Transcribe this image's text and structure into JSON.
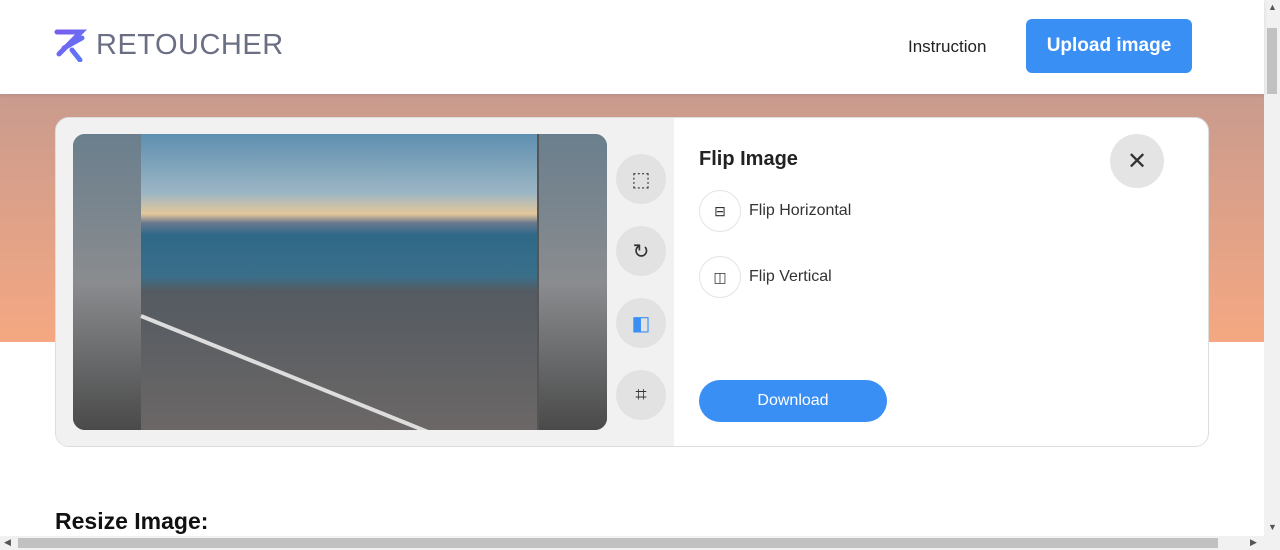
{
  "header": {
    "logo_text": "RETOUCHER",
    "instruction": "Instruction",
    "upload_label": "Upload image"
  },
  "editor": {
    "panel_title": "Flip Image",
    "options": [
      {
        "label": "Flip Horizontal",
        "icon": "flip-horizontal-icon"
      },
      {
        "label": "Flip Vertical",
        "icon": "flip-vertical-icon"
      }
    ],
    "download_label": "Download",
    "tools": [
      "resize-icon",
      "rotate-icon",
      "flip-icon",
      "crop-icon"
    ],
    "active_tool": "flip-icon"
  },
  "section_heading": "Resize Image:",
  "colors": {
    "accent": "#3a8ff5"
  }
}
